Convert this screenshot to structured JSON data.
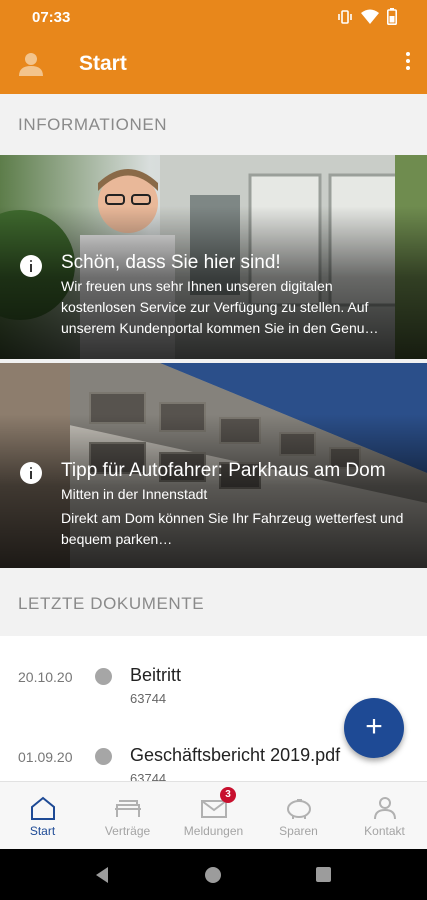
{
  "status_bar": {
    "time": "07:33",
    "icons": [
      "vibrate-icon",
      "wifi-icon",
      "battery-icon"
    ]
  },
  "app_bar": {
    "title": "Start",
    "left_icon": "user-icon",
    "right_icon": "more-vert-icon"
  },
  "sections": {
    "info_label": "INFORMATIONEN",
    "docs_label": "LETZTE DOKUMENTE"
  },
  "cards": [
    {
      "title": "Schön, dass Sie hier sind!",
      "text": "Wir freuen uns sehr Ihnen unseren digitalen kostenlosen Service zur Verfügung zu stellen. Auf unserem Kundenportal kommen Sie in den Genu…",
      "icon": "info-icon"
    },
    {
      "title": "Tipp für Autofahrer: Parkhaus am Dom",
      "line1": "Mitten in der Innenstadt",
      "text": "Direkt am Dom können Sie Ihr Fahrzeug wetterfest und bequem parken…",
      "icon": "info-icon"
    }
  ],
  "documents": [
    {
      "date": "20.10.20",
      "name": "Beitritt",
      "sub": "63744"
    },
    {
      "date": "01.09.20",
      "name": "Geschäftsbericht 2019.pdf",
      "sub": "63744"
    }
  ],
  "fab": {
    "label": "+"
  },
  "nav": {
    "items": [
      {
        "label": "Start",
        "icon": "home-icon"
      },
      {
        "label": "Verträge",
        "icon": "sofa-icon"
      },
      {
        "label": "Meldungen",
        "icon": "mail-icon",
        "badge": "3"
      },
      {
        "label": "Sparen",
        "icon": "piggy-bank-icon"
      },
      {
        "label": "Kontakt",
        "icon": "person-icon"
      }
    ]
  },
  "colors": {
    "primary": "#e8871b",
    "accent": "#1e4a95",
    "badge": "#c8102e"
  }
}
